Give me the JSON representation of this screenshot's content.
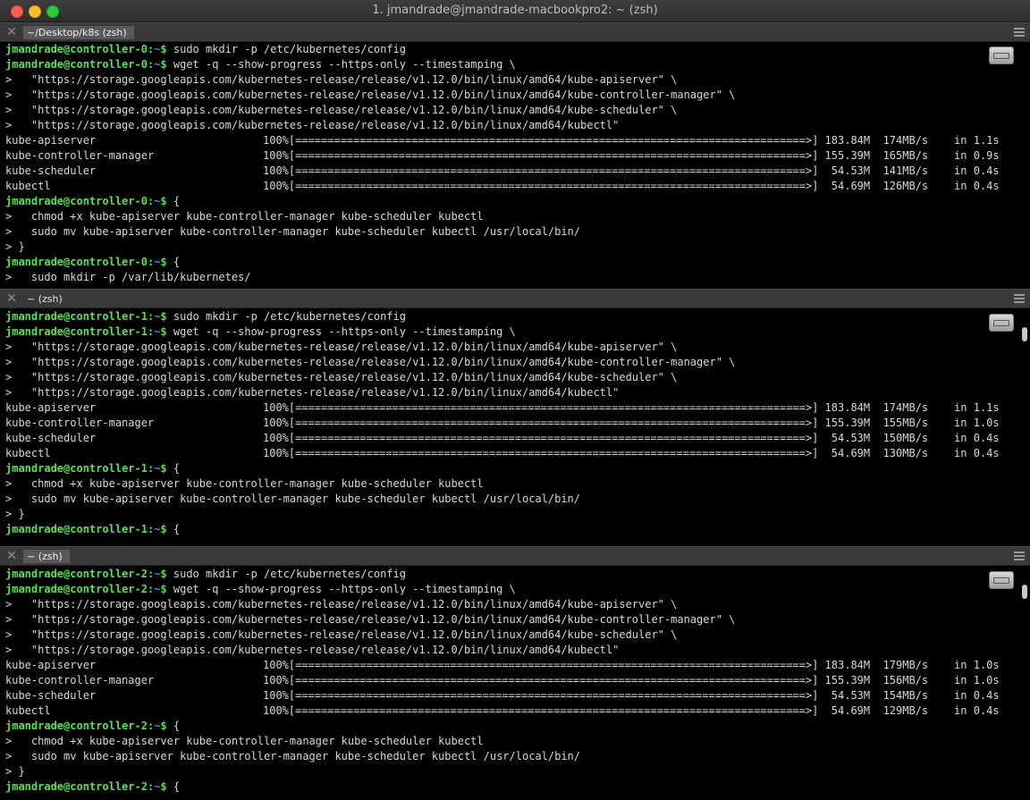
{
  "window": {
    "title": "1. jmandrade@jmandrade-macbookpro2: ~ (zsh)"
  },
  "panes": [
    {
      "tab": "~/Desktop/k8s (zsh)",
      "lines": [
        {
          "type": "prompt",
          "user": "jmandrade@controller-0",
          "sep": ":",
          "path": "~",
          "sym": "$",
          "cmd": " sudo mkdir -p /etc/kubernetes/config"
        },
        {
          "type": "prompt",
          "user": "jmandrade@controller-0",
          "sep": ":",
          "path": "~",
          "sym": "$",
          "cmd": " wget -q --show-progress --https-only --timestamping \\"
        },
        {
          "type": "text",
          "text": ">   \"https://storage.googleapis.com/kubernetes-release/release/v1.12.0/bin/linux/amd64/kube-apiserver\" \\"
        },
        {
          "type": "text",
          "text": ">   \"https://storage.googleapis.com/kubernetes-release/release/v1.12.0/bin/linux/amd64/kube-controller-manager\" \\"
        },
        {
          "type": "text",
          "text": ">   \"https://storage.googleapis.com/kubernetes-release/release/v1.12.0/bin/linux/amd64/kube-scheduler\" \\"
        },
        {
          "type": "text",
          "text": ">   \"https://storage.googleapis.com/kubernetes-release/release/v1.12.0/bin/linux/amd64/kubectl\""
        },
        {
          "type": "download",
          "name": "kube-apiserver",
          "pct": "100%",
          "bar": "[===============================================================================>]",
          "size": " 183.84M",
          "speed": "  174MB/s",
          "time": "    in 1.1s"
        },
        {
          "type": "download",
          "name": "kube-controller-manager",
          "pct": "100%",
          "bar": "[===============================================================================>]",
          "size": " 155.39M",
          "speed": "  165MB/s",
          "time": "    in 0.9s"
        },
        {
          "type": "download",
          "name": "kube-scheduler",
          "pct": "100%",
          "bar": "[===============================================================================>]",
          "size": "  54.53M",
          "speed": "  141MB/s",
          "time": "    in 0.4s"
        },
        {
          "type": "download",
          "name": "kubectl",
          "pct": "100%",
          "bar": "[===============================================================================>]",
          "size": "  54.69M",
          "speed": "  126MB/s",
          "time": "    in 0.4s"
        },
        {
          "type": "prompt",
          "user": "jmandrade@controller-0",
          "sep": ":",
          "path": "~",
          "sym": "$",
          "cmd": " {"
        },
        {
          "type": "text",
          "text": ">   chmod +x kube-apiserver kube-controller-manager kube-scheduler kubectl"
        },
        {
          "type": "text",
          "text": ">   sudo mv kube-apiserver kube-controller-manager kube-scheduler kubectl /usr/local/bin/"
        },
        {
          "type": "text",
          "text": "> }"
        },
        {
          "type": "prompt",
          "user": "jmandrade@controller-0",
          "sep": ":",
          "path": "~",
          "sym": "$",
          "cmd": " {"
        },
        {
          "type": "text",
          "text": ">   sudo mkdir -p /var/lib/kubernetes/"
        }
      ]
    },
    {
      "tab": "~ (zsh)",
      "lines": [
        {
          "type": "prompt",
          "user": "jmandrade@controller-1",
          "sep": ":",
          "path": "~",
          "sym": "$",
          "cmd": " sudo mkdir -p /etc/kubernetes/config"
        },
        {
          "type": "prompt",
          "user": "jmandrade@controller-1",
          "sep": ":",
          "path": "~",
          "sym": "$",
          "cmd": " wget -q --show-progress --https-only --timestamping \\"
        },
        {
          "type": "text",
          "text": ">   \"https://storage.googleapis.com/kubernetes-release/release/v1.12.0/bin/linux/amd64/kube-apiserver\" \\"
        },
        {
          "type": "text",
          "text": ">   \"https://storage.googleapis.com/kubernetes-release/release/v1.12.0/bin/linux/amd64/kube-controller-manager\" \\"
        },
        {
          "type": "text",
          "text": ">   \"https://storage.googleapis.com/kubernetes-release/release/v1.12.0/bin/linux/amd64/kube-scheduler\" \\"
        },
        {
          "type": "text",
          "text": ">   \"https://storage.googleapis.com/kubernetes-release/release/v1.12.0/bin/linux/amd64/kubectl\""
        },
        {
          "type": "download",
          "name": "kube-apiserver",
          "pct": "100%",
          "bar": "[===============================================================================>]",
          "size": " 183.84M",
          "speed": "  174MB/s",
          "time": "    in 1.1s"
        },
        {
          "type": "download",
          "name": "kube-controller-manager",
          "pct": "100%",
          "bar": "[===============================================================================>]",
          "size": " 155.39M",
          "speed": "  155MB/s",
          "time": "    in 1.0s"
        },
        {
          "type": "download",
          "name": "kube-scheduler",
          "pct": "100%",
          "bar": "[===============================================================================>]",
          "size": "  54.53M",
          "speed": "  150MB/s",
          "time": "    in 0.4s"
        },
        {
          "type": "download",
          "name": "kubectl",
          "pct": "100%",
          "bar": "[===============================================================================>]",
          "size": "  54.69M",
          "speed": "  130MB/s",
          "time": "    in 0.4s"
        },
        {
          "type": "prompt",
          "user": "jmandrade@controller-1",
          "sep": ":",
          "path": "~",
          "sym": "$",
          "cmd": " {"
        },
        {
          "type": "text",
          "text": ">   chmod +x kube-apiserver kube-controller-manager kube-scheduler kubectl"
        },
        {
          "type": "text",
          "text": ">   sudo mv kube-apiserver kube-controller-manager kube-scheduler kubectl /usr/local/bin/"
        },
        {
          "type": "text",
          "text": "> }"
        },
        {
          "type": "prompt",
          "user": "jmandrade@controller-1",
          "sep": ":",
          "path": "~",
          "sym": "$",
          "cmd": " {"
        }
      ]
    },
    {
      "tab": "~ (zsh)",
      "lines": [
        {
          "type": "prompt",
          "user": "jmandrade@controller-2",
          "sep": ":",
          "path": "~",
          "sym": "$",
          "cmd": " sudo mkdir -p /etc/kubernetes/config"
        },
        {
          "type": "prompt",
          "user": "jmandrade@controller-2",
          "sep": ":",
          "path": "~",
          "sym": "$",
          "cmd": " wget -q --show-progress --https-only --timestamping \\"
        },
        {
          "type": "text",
          "text": ">   \"https://storage.googleapis.com/kubernetes-release/release/v1.12.0/bin/linux/amd64/kube-apiserver\" \\"
        },
        {
          "type": "text",
          "text": ">   \"https://storage.googleapis.com/kubernetes-release/release/v1.12.0/bin/linux/amd64/kube-controller-manager\" \\"
        },
        {
          "type": "text",
          "text": ">   \"https://storage.googleapis.com/kubernetes-release/release/v1.12.0/bin/linux/amd64/kube-scheduler\" \\"
        },
        {
          "type": "text",
          "text": ">   \"https://storage.googleapis.com/kubernetes-release/release/v1.12.0/bin/linux/amd64/kubectl\""
        },
        {
          "type": "download",
          "name": "kube-apiserver",
          "pct": "100%",
          "bar": "[===============================================================================>]",
          "size": " 183.84M",
          "speed": "  179MB/s",
          "time": "    in 1.0s"
        },
        {
          "type": "download",
          "name": "kube-controller-manager",
          "pct": "100%",
          "bar": "[===============================================================================>]",
          "size": " 155.39M",
          "speed": "  156MB/s",
          "time": "    in 1.0s"
        },
        {
          "type": "download",
          "name": "kube-scheduler",
          "pct": "100%",
          "bar": "[===============================================================================>]",
          "size": "  54.53M",
          "speed": "  154MB/s",
          "time": "    in 0.4s"
        },
        {
          "type": "download",
          "name": "kubectl",
          "pct": "100%",
          "bar": "[===============================================================================>]",
          "size": "  54.69M",
          "speed": "  129MB/s",
          "time": "    in 0.4s"
        },
        {
          "type": "prompt",
          "user": "jmandrade@controller-2",
          "sep": ":",
          "path": "~",
          "sym": "$",
          "cmd": " {"
        },
        {
          "type": "text",
          "text": ">   chmod +x kube-apiserver kube-controller-manager kube-scheduler kubectl"
        },
        {
          "type": "text",
          "text": ">   sudo mv kube-apiserver kube-controller-manager kube-scheduler kubectl /usr/local/bin/"
        },
        {
          "type": "text",
          "text": "> }"
        },
        {
          "type": "prompt",
          "user": "jmandrade@controller-2",
          "sep": ":",
          "path": "~",
          "sym": "$",
          "cmd": " {"
        }
      ]
    }
  ],
  "colors": {
    "prompt_user": "#54e34d",
    "prompt_path": "#5fb1ff",
    "text": "#d8d8d8",
    "background": "#000000"
  },
  "icons": {
    "pane_close": "close-icon",
    "pane_menu": "hamburger-menu-icon",
    "keyboard": "keyboard-icon"
  }
}
